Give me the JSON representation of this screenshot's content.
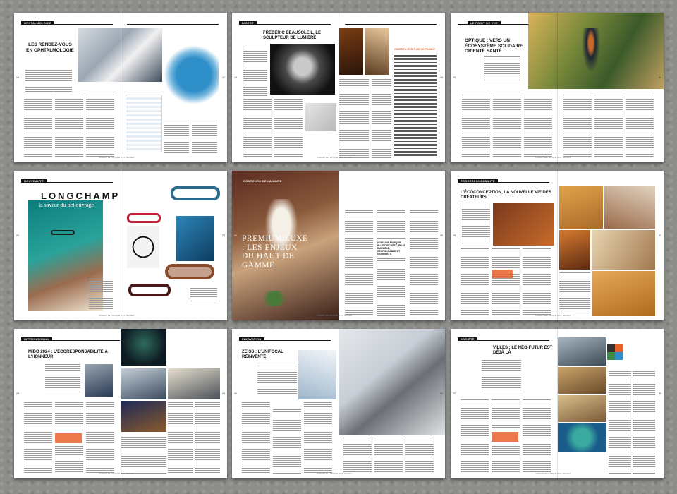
{
  "spreads": [
    {
      "rubric": "OPHTALMOLOGIE",
      "title": "LES RENDEZ-VOUS EN OPHTALMOLOGIE",
      "page_left": "16",
      "page_right": "17",
      "footer": "CONCEPT DE L'OPTIQUE N°XX · MAI 2024"
    },
    {
      "rubric": "DIGEST",
      "title": "FRÉDÉRIC BEAUSOLEIL, LE SCULPTEUR DE LUMIÈRE",
      "sidebar_title": "CONTRE L'ÉCRITURE DE FRANCE",
      "page_left": "18",
      "page_right": "19",
      "footer": "CONCEPT DE L'OPTIQUE N°XX · MAI 2024"
    },
    {
      "rubric": "LE POINT DE VUE",
      "title": "OPTIQUE : VERS UN ÉCOSYSTÈME SOLIDAIRE ORIENTÉ SANTÉ",
      "page_left": "20",
      "page_right": "21",
      "footer": "CONCEPT DE L'OPTIQUE N°XX · MAI 2024"
    },
    {
      "rubric": "NOUVEAUTÉ",
      "brand": "LONGCHAMP",
      "tagline": "la saveur du bel ouvrage",
      "page_left": "22",
      "page_right": "23",
      "footer": "CONCEPT DE L'OPTIQUE N°XX · MAI 2024"
    },
    {
      "rubric": "CONTOURS DE LA MODE",
      "title": "PREMIUM/LUXE : LES ENJEUX DU HAUT DE GAMME",
      "quote": "VOIR UNE MARQUE PLUS DISCRÈTE, PLUS DURABLE, RESPONSABLE ET GOURMETS",
      "page_left": "24",
      "page_right": "25",
      "footer": "CONCEPT DE L'OPTIQUE N°XX · MAI 2024"
    },
    {
      "rubric": "ÉCORESPONSABILITÉ",
      "title": "L'ÉCOCONCEPTION, LA NOUVELLE VIE DES CRÉATEURS",
      "page_left": "26",
      "page_right": "27",
      "footer": "CONCEPT DE L'OPTIQUE N°XX · MAI 2024"
    },
    {
      "rubric": "INTERNATIONAL",
      "title": "MIDO 2024 : L'ÉCORESPONSABILITÉ À L'HONNEUR",
      "page_left": "28",
      "page_right": "29",
      "footer": "CONCEPT DE L'OPTIQUE N°XX · MAI 2024"
    },
    {
      "rubric": "INNOVATION",
      "title": "ZEISS : L'UNIFOCAL RÉINVENTÉ",
      "page_left": "30",
      "page_right": "31",
      "footer": "CONCEPT DE L'OPTIQUE N°XX · MAI 2024"
    },
    {
      "rubric": "SOCIÉTÉ",
      "title": "VILLES : LE NÉO-FUTUR EST DÉJÀ LÀ",
      "page_left": "32",
      "page_right": "33",
      "footer": "CONCEPT DE L'OPTIQUE N°XX · MAI 2024"
    }
  ],
  "colors": {
    "background": "#8d8d8b",
    "accent_orange": "#e8622c",
    "map_blue": "#2f8fc9",
    "ink": "#111111"
  }
}
